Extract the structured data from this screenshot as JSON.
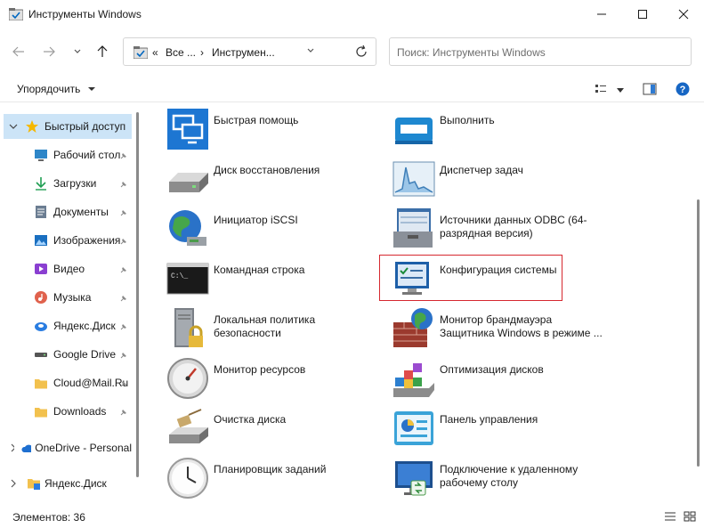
{
  "window": {
    "title": "Инструменты Windows",
    "controls": {
      "minimize": "—",
      "maximize": "☐",
      "close": "✕"
    }
  },
  "nav": {
    "back_icon": "arrow-left-icon",
    "forward_icon": "arrow-right-icon",
    "recent_icon": "chevron-down-icon",
    "up_icon": "arrow-up-icon"
  },
  "address": {
    "overflow": "«",
    "segments": [
      "Все ...",
      "Инструмен..."
    ],
    "separator": "›",
    "refresh_icon": "refresh-icon"
  },
  "search": {
    "placeholder": "Поиск: Инструменты Windows"
  },
  "toolbar": {
    "organize_label": "Упорядочить",
    "help": "?"
  },
  "sidebar": {
    "quick_access": "Быстрый доступ",
    "items": [
      {
        "label": "Рабочий стол",
        "icon": "desktop-icon",
        "pinned": true
      },
      {
        "label": "Загрузки",
        "icon": "download-icon",
        "pinned": true
      },
      {
        "label": "Документы",
        "icon": "documents-icon",
        "pinned": true
      },
      {
        "label": "Изображения",
        "icon": "pictures-icon",
        "pinned": true
      },
      {
        "label": "Видео",
        "icon": "video-icon",
        "pinned": true
      },
      {
        "label": "Музыка",
        "icon": "music-icon",
        "pinned": true
      },
      {
        "label": "Яндекс.Диск",
        "icon": "yandex-disk-icon",
        "pinned": true
      },
      {
        "label": "Google Drive",
        "icon": "drive-icon",
        "pinned": true
      },
      {
        "label": "Cloud@Mail.Ru",
        "icon": "folder-icon",
        "pinned": true
      },
      {
        "label": "Downloads",
        "icon": "folder-icon",
        "pinned": true
      }
    ],
    "roots": [
      {
        "label": "OneDrive - Personal",
        "icon": "onedrive-icon"
      },
      {
        "label": "Яндекс.Диск",
        "icon": "yandex-disk-icon"
      }
    ]
  },
  "tools": {
    "left": [
      {
        "name": "Быстрая помощь",
        "icon": "quick-assist-icon"
      },
      {
        "name": "Диск восстановления",
        "icon": "recovery-drive-icon"
      },
      {
        "name": "Инициатор iSCSI",
        "icon": "iscsi-globe-icon"
      },
      {
        "name": "Командная строка",
        "icon": "cmd-icon"
      },
      {
        "name": "Локальная политика безопасности",
        "icon": "security-policy-icon"
      },
      {
        "name": "Монитор ресурсов",
        "icon": "resource-monitor-icon"
      },
      {
        "name": "Очистка диска",
        "icon": "disk-cleanup-icon"
      },
      {
        "name": "Планировщик заданий",
        "icon": "task-scheduler-icon"
      }
    ],
    "right": [
      {
        "name": "Выполнить",
        "icon": "run-icon"
      },
      {
        "name": "Диспетчер задач",
        "icon": "task-manager-icon"
      },
      {
        "name": "Источники данных ODBC (64-разрядная версия)",
        "icon": "odbc-icon"
      },
      {
        "name": "Конфигурация системы",
        "icon": "msconfig-icon",
        "highlighted": true
      },
      {
        "name": "Монитор брандмауэра Защитника Windows в режиме ...",
        "icon": "firewall-icon"
      },
      {
        "name": "Оптимизация дисков",
        "icon": "defrag-icon"
      },
      {
        "name": "Панель управления",
        "icon": "control-panel-icon"
      },
      {
        "name": "Подключение к удаленному рабочему столу",
        "icon": "remote-desktop-icon"
      }
    ]
  },
  "status": {
    "items_count": "Элементов: 36"
  },
  "colors": {
    "accent": "#0067c0",
    "selected_bg": "#cce4f7",
    "highlight_border": "#d6282f"
  }
}
